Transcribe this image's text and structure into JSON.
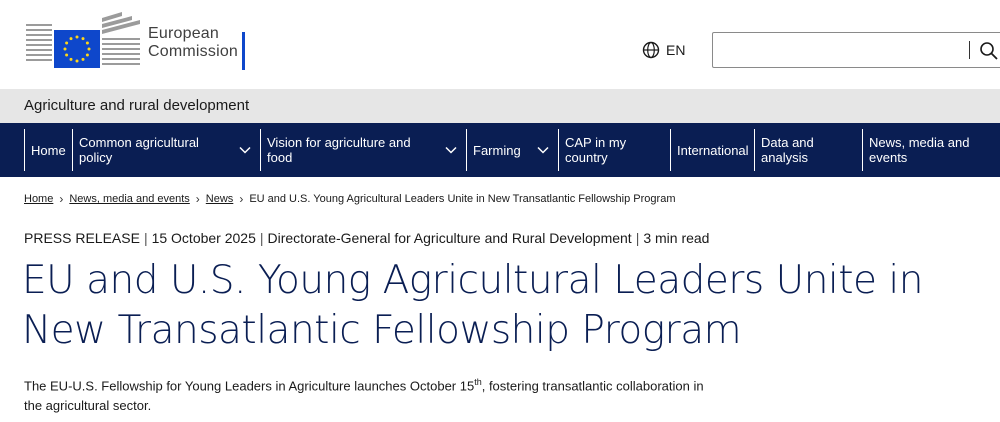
{
  "header": {
    "logo_line1": "European",
    "logo_line2": "Commission",
    "language": "EN",
    "search_value": "",
    "search_placeholder": ""
  },
  "site": {
    "title": "Agriculture and rural development"
  },
  "nav": {
    "items": [
      {
        "label": "Home",
        "has_dropdown": false
      },
      {
        "label": "Common agricultural policy",
        "has_dropdown": true
      },
      {
        "label": "Vision for agriculture and food",
        "has_dropdown": true
      },
      {
        "label": "Farming",
        "has_dropdown": true
      },
      {
        "label": "CAP in my country",
        "has_dropdown": false
      },
      {
        "label": "International",
        "has_dropdown": false
      },
      {
        "label": "Data and analysis",
        "has_dropdown": false
      },
      {
        "label": "News, media and events",
        "has_dropdown": false
      }
    ]
  },
  "breadcrumb": {
    "items": [
      "Home",
      "News, media and events",
      "News"
    ],
    "current": "EU and U.S. Young Agricultural Leaders Unite in New Transatlantic Fellowship Program"
  },
  "meta": {
    "type": "PRESS RELEASE",
    "date": "15 October 2025",
    "department": "Directorate-General for Agriculture and Rural Development",
    "read_time": "3 min read"
  },
  "article": {
    "title": "EU and U.S. Young Agricultural Leaders Unite in New Transatlantic Fellowship Program",
    "lead_part1": "The EU-U.S. Fellowship for Young Leaders in Agriculture launches October 15",
    "lead_sup": "th",
    "lead_part2": ", fostering transatlantic collaboration in the agricultural sector."
  },
  "icons": {
    "globe": "globe-icon",
    "search": "search-icon",
    "chevron": "chevron-down-icon",
    "breadcrumb_sep": "chevron-right-icon"
  },
  "colors": {
    "nav_bg": "#0a1e53",
    "title": "#0a1e53",
    "eu_blue": "#0e47cb",
    "eu_star": "#ffd617",
    "site_bar": "#e6e6e6"
  }
}
